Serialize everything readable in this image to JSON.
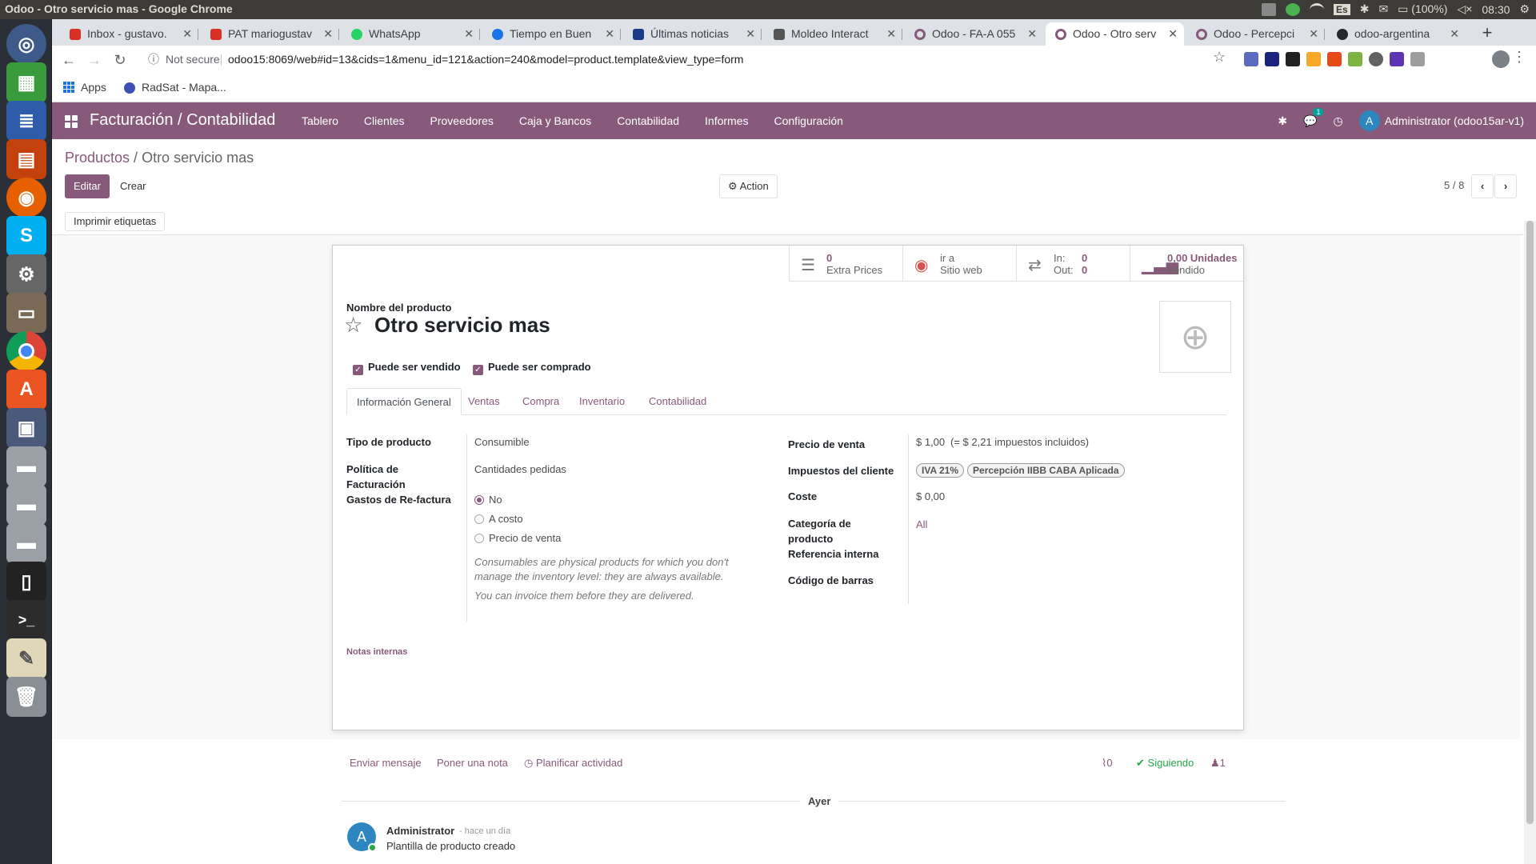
{
  "os": {
    "window_title": "Odoo - Otro servicio mas - Google Chrome",
    "lang": "Es",
    "battery": "(100%)",
    "time": "08:30"
  },
  "launcher": {
    "icons": [
      "ubuntu-dash-icon",
      "spreadsheet-icon",
      "writer-icon",
      "impress-icon",
      "firefox-icon",
      "skype-icon",
      "settings-icon",
      "files-icon",
      "chrome-icon",
      "software-center-icon",
      "workspace-icon",
      "drive-icon",
      "drive-icon",
      "drive-icon",
      "phone-icon",
      "terminal-icon",
      "text-editor-icon",
      "trash-icon"
    ]
  },
  "chrome": {
    "tabs": [
      {
        "label": "Inbox - gustavo.",
        "color": "#d93025"
      },
      {
        "label": "PAT mariogustav",
        "color": "#d93025"
      },
      {
        "label": "WhatsApp",
        "color": "#25d366"
      },
      {
        "label": "Tiempo en Buen",
        "color": "#1a73e8"
      },
      {
        "label": "Últimas noticias",
        "color": "#1a3a8a"
      },
      {
        "label": "Moldeo Interact",
        "color": "#555555"
      },
      {
        "label": "Odoo - FA-A 055",
        "color": "#875a7b"
      },
      {
        "label": "Odoo - Otro serv",
        "color": "#875a7b"
      },
      {
        "label": "Odoo - Percepci",
        "color": "#875a7b"
      },
      {
        "label": "odoo-argentina",
        "color": "#24292e"
      }
    ],
    "active_tab": 7,
    "not_secure": "Not secure",
    "url": "odoo15:8069/web#id=13&cids=1&menu_id=121&action=240&model=product.template&view_type=form",
    "bookmarks": [
      "Apps",
      "RadSat - Mapa..."
    ]
  },
  "odoo": {
    "app_name": "Facturación / Contabilidad",
    "menu": [
      "Tablero",
      "Clientes",
      "Proveedores",
      "Caja y Bancos",
      "Contabilidad",
      "Informes",
      "Configuración"
    ],
    "messages_count": "1",
    "user": "Administrator (odoo15ar-v1)",
    "user_initial": "A",
    "breadcrumb_parent": "Productos",
    "breadcrumb_sep": " / ",
    "breadcrumb_current": "Otro servicio mas",
    "edit_label": "Editar",
    "create_label": "Crear",
    "action_label": "Action",
    "pager": "5 / 8",
    "print_labels": "Imprimir etiquetas"
  },
  "form": {
    "stats": [
      {
        "l1": "0",
        "l2": "Extra Prices",
        "icon": "list-icon"
      },
      {
        "l1": "ir a",
        "l2": "Sitio web",
        "icon": "globe-icon"
      },
      {
        "l1": "In:",
        "v1": "0",
        "l2": "Out:",
        "v2": "0",
        "icon": "exchange-icon"
      },
      {
        "l1": "0,00 Unidades",
        "l2": "Vendido",
        "icon": "signal-icon"
      }
    ],
    "name_label": "Nombre del producto",
    "name": "Otro servicio mas",
    "can_be_sold": "Puede ser vendido",
    "can_be_purchased": "Puede ser comprado",
    "tabs": [
      "Información General",
      "Ventas",
      "Compra",
      "Inventario",
      "Contabilidad"
    ],
    "left": {
      "type_label": "Tipo de producto",
      "type_value": "Consumible",
      "policy_label_1": "Política de",
      "policy_label_2": "Facturación",
      "policy_value": "Cantidades pedidas",
      "expense_label": "Gastos de Re-factura",
      "radio_options": [
        "No",
        "A costo",
        "Precio de venta"
      ],
      "help_1": "Consumables are physical products for which you don't",
      "help_2": "manage the inventory level: they are always available.",
      "help_3": "You can invoice them before they are delivered."
    },
    "right": {
      "price_label": "Precio de venta",
      "price_value": "$ 1,00",
      "price_taxed": "(= $ 2,21 impuestos incluidos)",
      "taxes_label": "Impuestos del cliente",
      "taxes": [
        "IVA 21%",
        "Percepción IIBB CABA Aplicada"
      ],
      "cost_label": "Coste",
      "cost_value": "$ 0,00",
      "categ_label_1": "Categoría de",
      "categ_label_2": "producto",
      "categ_value": "All",
      "ref_label": "Referencia interna",
      "barcode_label": "Código de barras"
    },
    "notes_label": "Notas internas"
  },
  "chatter": {
    "send_message": "Enviar mensaje",
    "log_note": "Poner una nota",
    "schedule": "Planificar actividad",
    "attachments": "0",
    "following": "Siguiendo",
    "followers": "1",
    "date_sep": "Ayer",
    "author": "Administrator",
    "when": "- hace un día",
    "message": "Plantilla de producto creado",
    "author_initial": "A"
  }
}
